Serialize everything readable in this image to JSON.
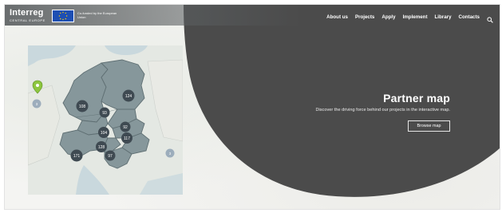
{
  "header": {
    "logo_text": "Interreg",
    "logo_subtext": "CENTRAL EUROPE",
    "cofunded_text": "Co-funded by the European Union",
    "nav": [
      {
        "label": "About us"
      },
      {
        "label": "Projects"
      },
      {
        "label": "Apply"
      },
      {
        "label": "Implement"
      },
      {
        "label": "Library"
      },
      {
        "label": "Contacts"
      }
    ],
    "search_icon": "search-icon"
  },
  "hero": {
    "title": "Partner map",
    "description": "Discover the driving force behind our projects in the interactive map.",
    "button_label": "Browse map"
  },
  "map": {
    "region_color": "#86979b",
    "cluster_color": "#3f4a52",
    "marker_color": "#8dc63f",
    "clusters": [
      {
        "label": "124"
      },
      {
        "label": "108"
      },
      {
        "label": "93"
      },
      {
        "label": "104"
      },
      {
        "label": "92"
      },
      {
        "label": "117"
      },
      {
        "label": "128"
      },
      {
        "label": "171"
      },
      {
        "label": "97"
      },
      {
        "label": "3"
      },
      {
        "label": "3"
      }
    ]
  },
  "colors": {
    "dark_shape": "#4b4b4b",
    "header_bg": "#5a5e60",
    "eu_blue": "#1d4fb3"
  }
}
